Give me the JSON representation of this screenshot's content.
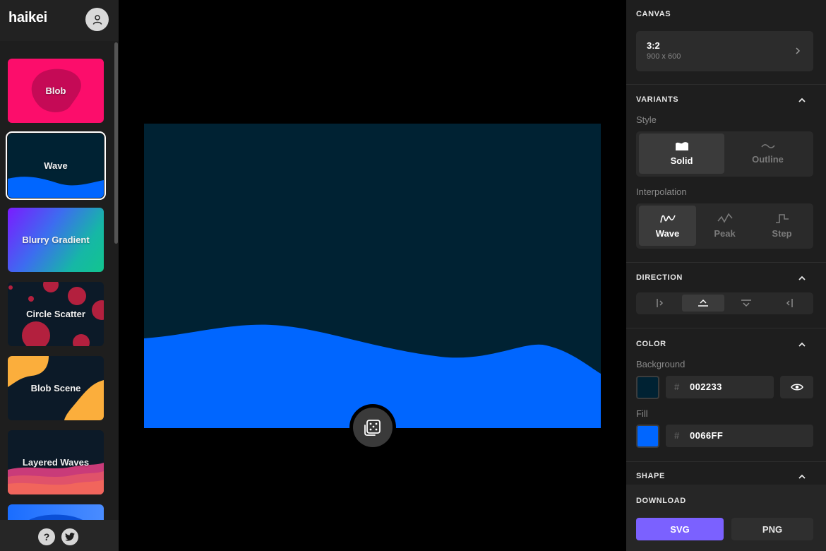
{
  "app": {
    "logo": "haikei"
  },
  "sidebar": {
    "items": [
      {
        "label": "Blob"
      },
      {
        "label": "Wave"
      },
      {
        "label": "Blurry Gradient"
      },
      {
        "label": "Circle Scatter"
      },
      {
        "label": "Blob Scene"
      },
      {
        "label": "Layered Waves"
      }
    ],
    "footer": {
      "help_label": "?"
    }
  },
  "panel": {
    "canvas": {
      "title": "CANVAS",
      "ratio": "3:2",
      "size": "900 x 600"
    },
    "variants": {
      "title": "VARIANTS",
      "style_label": "Style",
      "style_options": [
        "Solid",
        "Outline"
      ],
      "interpolation_label": "Interpolation",
      "interpolation_options": [
        "Wave",
        "Peak",
        "Step"
      ]
    },
    "direction": {
      "title": "DIRECTION"
    },
    "color": {
      "title": "COLOR",
      "background_label": "Background",
      "background_hash": "#",
      "background_hex": "002233",
      "fill_label": "Fill",
      "fill_hash": "#",
      "fill_hex": "0066FF"
    },
    "shape": {
      "title": "SHAPE"
    },
    "download": {
      "title": "DOWNLOAD",
      "svg_label": "SVG",
      "png_label": "PNG"
    }
  },
  "colors": {
    "background": "#002233",
    "fill": "#0066FF",
    "accent": "#7b61ff"
  }
}
